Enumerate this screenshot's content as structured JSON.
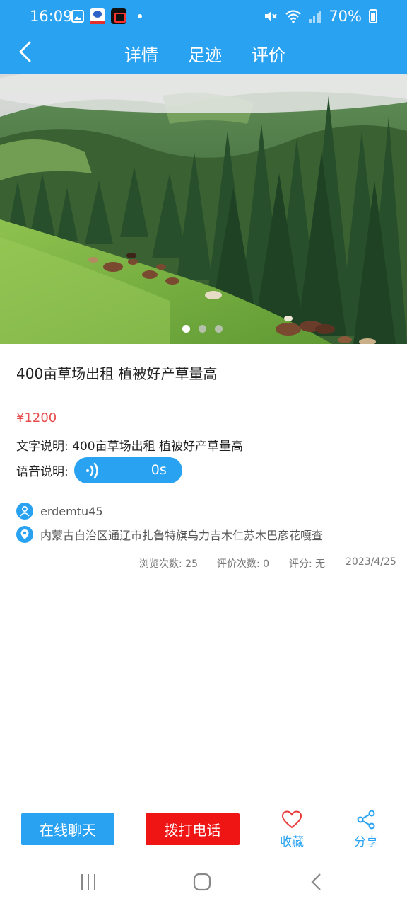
{
  "status_bar": {
    "time": "16:09",
    "battery": "70%",
    "icons_left": [
      "gallery-icon",
      "app-icon",
      "screen-recorder-icon",
      "notification-dot"
    ],
    "icons_right": [
      "mute-icon",
      "wifi-icon",
      "signal-icon",
      "battery-icon"
    ]
  },
  "header": {
    "tabs": [
      "详情",
      "足迹",
      "评价"
    ],
    "background": "#2aa2f2"
  },
  "carousel": {
    "dots": 3,
    "active_index": 0
  },
  "listing": {
    "title": "400亩草场出租 植被好产草量高",
    "price": "¥1200",
    "desc_label": "文字说明:",
    "desc_text": "400亩草场出租 植被好产草量高",
    "voice_label": "语音说明:",
    "voice_duration": "0s",
    "username": "erdemtu45",
    "location": "内蒙古自治区通辽市扎鲁特旗乌力吉木仁苏木巴彦花嘎查",
    "stats": {
      "views": "浏览次数: 25",
      "reviews": "评价次数: 0",
      "score": "评分: 无",
      "date": "2023/4/25"
    }
  },
  "bottom_bar": {
    "chat": "在线聊天",
    "call": "拨打电话",
    "favorite": "收藏",
    "share": "分享",
    "accent": "#2aa2f2",
    "call_color": "#f01515",
    "favorite_icon_color": "#e83a3a"
  }
}
